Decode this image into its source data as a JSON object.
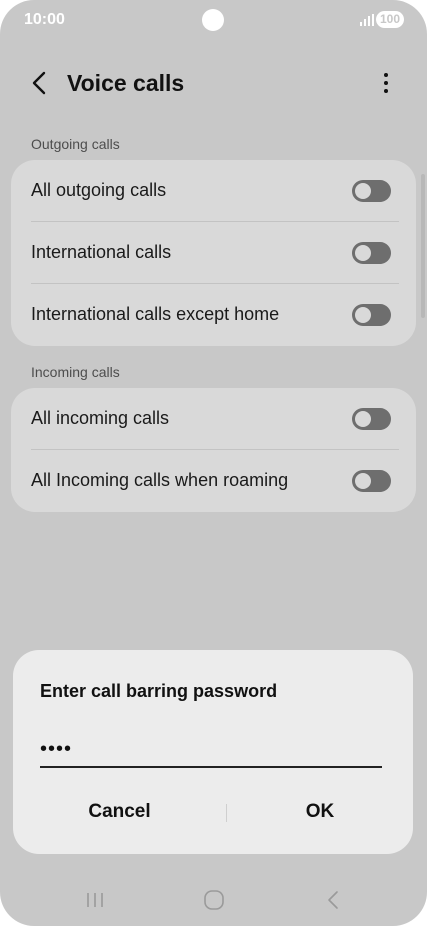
{
  "status_bar": {
    "time": "10:00",
    "battery": "100",
    "icons": [
      "camera-cutout",
      "signal-icon",
      "battery-icon"
    ]
  },
  "app_bar": {
    "title": "Voice calls",
    "icons": [
      "back-arrow-icon",
      "more-options-icon"
    ]
  },
  "sections": [
    {
      "label": "Outgoing calls",
      "items": [
        {
          "label": "All outgoing calls",
          "enabled": false
        },
        {
          "label": "International calls",
          "enabled": false
        },
        {
          "label": "International calls except home",
          "enabled": false
        }
      ]
    },
    {
      "label": "Incoming calls",
      "items": [
        {
          "label": "All incoming calls",
          "enabled": false
        },
        {
          "label": "All Incoming calls when roaming",
          "enabled": false
        }
      ]
    }
  ],
  "dialog": {
    "title": "Enter call barring password",
    "password_value": "••••",
    "cancel_label": "Cancel",
    "ok_label": "OK"
  },
  "nav_bar": {
    "icons": [
      "recents-icon",
      "home-icon",
      "back-icon"
    ]
  },
  "colors": {
    "dimmed_background": "#c8c8c8",
    "card_background": "#d9d9d9",
    "dialog_background": "#ececec",
    "toggle_off": "#6e6e6e"
  }
}
